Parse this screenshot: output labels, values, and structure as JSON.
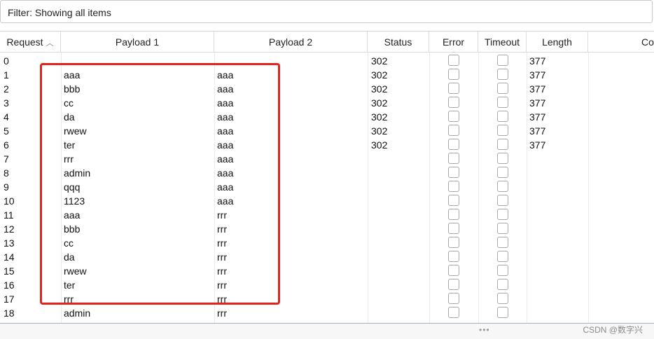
{
  "filter": {
    "text": "Filter: Showing all items"
  },
  "columns": [
    "Request",
    "Payload 1",
    "Payload 2",
    "Status",
    "Error",
    "Timeout",
    "Length",
    "Co"
  ],
  "rows": [
    {
      "request": "0",
      "payload1": "",
      "payload2": "",
      "status": "302",
      "length": "377"
    },
    {
      "request": "1",
      "payload1": "aaa",
      "payload2": "aaa",
      "status": "302",
      "length": "377"
    },
    {
      "request": "2",
      "payload1": "bbb",
      "payload2": "aaa",
      "status": "302",
      "length": "377"
    },
    {
      "request": "3",
      "payload1": "cc",
      "payload2": "aaa",
      "status": "302",
      "length": "377"
    },
    {
      "request": "4",
      "payload1": "da",
      "payload2": "aaa",
      "status": "302",
      "length": "377"
    },
    {
      "request": "5",
      "payload1": "rwew",
      "payload2": "aaa",
      "status": "302",
      "length": "377"
    },
    {
      "request": "6",
      "payload1": "ter",
      "payload2": "aaa",
      "status": "302",
      "length": "377"
    },
    {
      "request": "7",
      "payload1": "rrr",
      "payload2": "aaa",
      "status": "",
      "length": ""
    },
    {
      "request": "8",
      "payload1": "admin",
      "payload2": "aaa",
      "status": "",
      "length": ""
    },
    {
      "request": "9",
      "payload1": "qqq",
      "payload2": "aaa",
      "status": "",
      "length": ""
    },
    {
      "request": "10",
      "payload1": "1123",
      "payload2": "aaa",
      "status": "",
      "length": ""
    },
    {
      "request": "11",
      "payload1": "aaa",
      "payload2": "rrr",
      "status": "",
      "length": ""
    },
    {
      "request": "12",
      "payload1": "bbb",
      "payload2": "rrr",
      "status": "",
      "length": ""
    },
    {
      "request": "13",
      "payload1": "cc",
      "payload2": "rrr",
      "status": "",
      "length": ""
    },
    {
      "request": "14",
      "payload1": "da",
      "payload2": "rrr",
      "status": "",
      "length": ""
    },
    {
      "request": "15",
      "payload1": "rwew",
      "payload2": "rrr",
      "status": "",
      "length": ""
    },
    {
      "request": "16",
      "payload1": "ter",
      "payload2": "rrr",
      "status": "",
      "length": ""
    },
    {
      "request": "17",
      "payload1": "rrr",
      "payload2": "rrr",
      "status": "",
      "length": ""
    },
    {
      "request": "18",
      "payload1": "admin",
      "payload2": "rrr",
      "status": "",
      "length": ""
    }
  ],
  "sort_icon": "chevron-up-icon",
  "resize_handle": "•••",
  "watermark": "CSDN @数字兴",
  "colors": {
    "highlight": "#e4231d",
    "border": "#c9c9c9"
  }
}
